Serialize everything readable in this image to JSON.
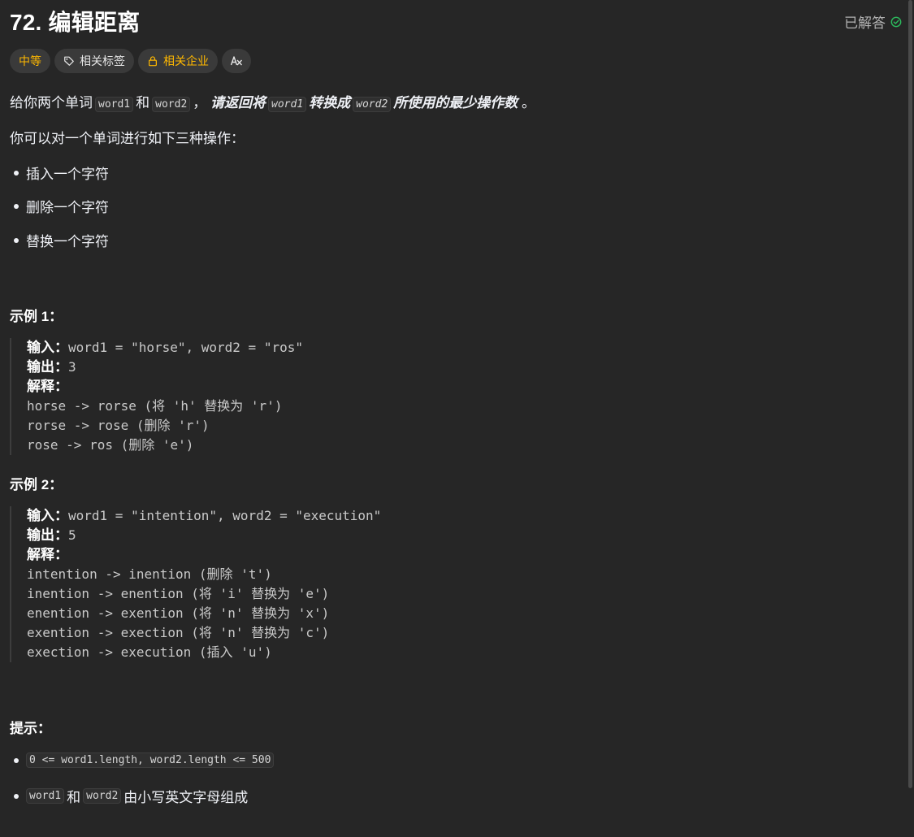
{
  "problem": {
    "title": "72. 编辑距离",
    "status": "已解答"
  },
  "tags": {
    "difficulty": "中等",
    "related_tags": "相关标签",
    "related_companies": "相关企业",
    "translate_icon": "Aあ"
  },
  "description": {
    "intro_prefix": "给你两个单词",
    "word1": "word1",
    "and": "和",
    "word2": "word2",
    "comma": "，",
    "ask": "请返回将",
    "convert": "转换成",
    "suffix": "所使用的最少操作数",
    "period": "。",
    "ops_intro": "你可以对一个单词进行如下三种操作：",
    "ops": [
      "插入一个字符",
      "删除一个字符",
      "替换一个字符"
    ]
  },
  "examples": [
    {
      "heading": "示例 1：",
      "input_label": "输入：",
      "input": "word1 = \"horse\", word2 = \"ros\"",
      "output_label": "输出：",
      "output": "3",
      "explain_label": "解释：",
      "steps": [
        "horse -> rorse (将 'h' 替换为 'r')",
        "rorse -> rose (删除 'r')",
        "rose -> ros (删除 'e')"
      ]
    },
    {
      "heading": "示例 2：",
      "input_label": "输入：",
      "input": "word1 = \"intention\", word2 = \"execution\"",
      "output_label": "输出：",
      "output": "5",
      "explain_label": "解释：",
      "steps": [
        "intention -> inention (删除 't')",
        "inention -> enention (将 'i' 替换为 'e')",
        "enention -> exention (将 'n' 替换为 'x')",
        "exention -> exection (将 'n' 替换为 'c')",
        "exection -> execution (插入 'u')"
      ]
    }
  ],
  "hints": {
    "heading": "提示：",
    "constraint1": "0 <= word1.length, word2.length <= 500",
    "word1": "word1",
    "and": "和",
    "word2": "word2",
    "constraint2_suffix": "由小写英文字母组成"
  },
  "colors": {
    "background": "#262626",
    "difficulty": "#ffb800",
    "solved_check": "#2cbb5d"
  }
}
